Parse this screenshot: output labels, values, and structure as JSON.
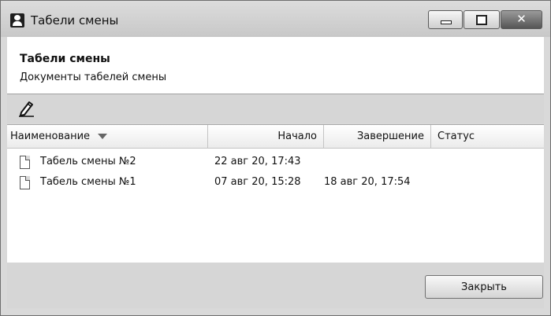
{
  "window": {
    "title": "Табели смены",
    "controls": [
      "minimize-icon",
      "maximize-icon",
      "close-icon"
    ]
  },
  "header": {
    "title": "Табели смены",
    "subtitle": "Документы табелей смены"
  },
  "toolbar": {
    "edit_icon": "pencil-icon"
  },
  "table": {
    "columns": [
      "Наименование",
      "Начало",
      "Завершение",
      "Статус"
    ],
    "sort_column": "Наименование",
    "rows": [
      {
        "name": "Табель смены №2",
        "start": "22 авг 20, 17:43",
        "end": "",
        "status": ""
      },
      {
        "name": "Табель смены №1",
        "start": "07 авг 20, 15:28",
        "end": "18 авг 20, 17:54",
        "status": ""
      }
    ]
  },
  "footer": {
    "close_label": "Закрыть"
  },
  "colors": {
    "chrome": "#d9d9d9",
    "content": "#ffffff",
    "border": "#6e6e6e"
  }
}
